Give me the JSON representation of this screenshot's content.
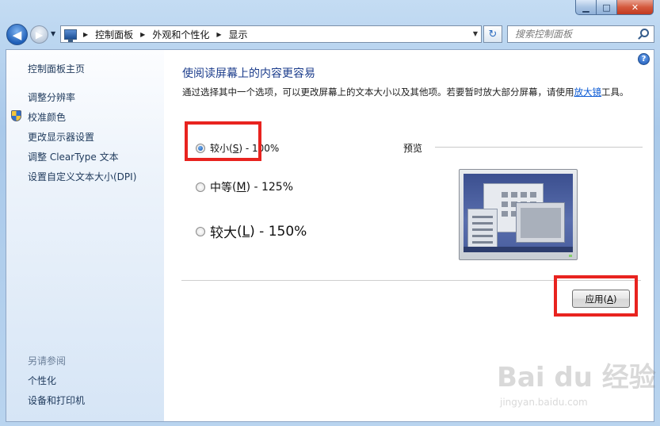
{
  "window": {
    "min_glyph": "▁",
    "max_glyph": "□",
    "close_glyph": "✕"
  },
  "nav": {
    "back_glyph": "◀",
    "forward_glyph": "▶",
    "breadcrumb": [
      "控制面板",
      "外观和个性化",
      "显示"
    ],
    "search_placeholder": "搜索控制面板"
  },
  "sidebar": {
    "home": "控制面板主页",
    "items": [
      "调整分辨率",
      "校准颜色",
      "更改显示器设置",
      "调整 ClearType 文本",
      "设置自定义文本大小(DPI)"
    ],
    "see_also_title": "另请参阅",
    "see_also": [
      "个性化",
      "设备和打印机"
    ]
  },
  "main": {
    "title": "使阅读屏幕上的内容更容易",
    "description": "通过选择其中一个选项，可以更改屏幕上的文本大小以及其他项。若要暂时放大部分屏幕，请使用",
    "magnifier_link": "放大镜",
    "description_end": "工具。",
    "options": [
      {
        "label": "较小",
        "mnemonic": "S",
        "value": "- 100%",
        "selected": true
      },
      {
        "label": "中等",
        "mnemonic": "M",
        "value": "- 125%",
        "selected": false
      },
      {
        "label": "较大",
        "mnemonic": "L",
        "value": "- 150%",
        "selected": false
      }
    ],
    "preview_label": "预览",
    "apply_label": "应用",
    "apply_mnemonic": "A"
  },
  "watermark": {
    "brand": "Bai du 经验",
    "url": "jingyan.baidu.com"
  },
  "colors": {
    "highlight": "#e8231f",
    "title": "#1c3d8c",
    "link": "#1e395b"
  }
}
